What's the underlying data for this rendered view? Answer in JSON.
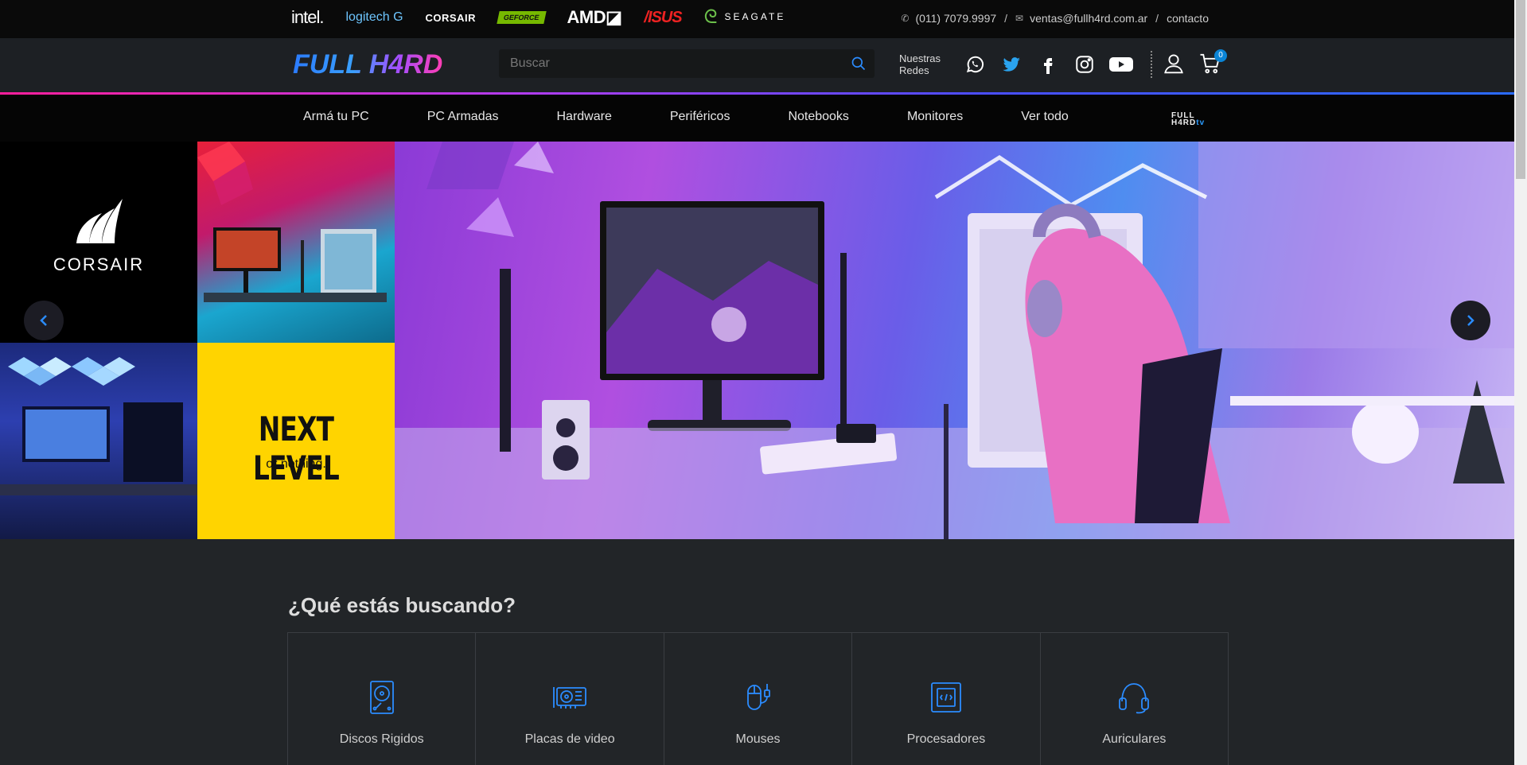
{
  "brands": [
    {
      "name": "intel",
      "label": "intel."
    },
    {
      "name": "logitech",
      "label": "logitech G"
    },
    {
      "name": "corsair",
      "label": "CORSAIR"
    },
    {
      "name": "geforce",
      "label": "GEFORCE"
    },
    {
      "name": "amd",
      "label": "AMD◪"
    },
    {
      "name": "asus",
      "label": "/ISUS"
    },
    {
      "name": "seagate",
      "label": "SEAGATE"
    }
  ],
  "contact": {
    "phone": "(011) 7079.9997",
    "email": "ventas@fullh4rd.com.ar",
    "link": "contacto",
    "separator": "/"
  },
  "header": {
    "logo": "FULL H4RD",
    "search_placeholder": "Buscar",
    "redes_label_1": "Nuestras",
    "redes_label_2": "Redes",
    "cart_count": "0"
  },
  "nav": {
    "items": [
      "Armá tu PC",
      "PC Armadas",
      "Hardware",
      "Periféricos",
      "Notebooks",
      "Monitores",
      "Ver todo"
    ],
    "logo_line1": "FULL",
    "logo_line2": "H4RD",
    "logo_suffix": "tv"
  },
  "hero": {
    "corsair_name": "CORSAIR",
    "slogan_big": "NEXT LEVEL",
    "slogan_small": "or nothing."
  },
  "categories": {
    "title": "¿Qué estás buscando?",
    "items": [
      "Discos Rigidos",
      "Placas de video",
      "Mouses",
      "Procesadores",
      "Auriculares"
    ]
  },
  "colors": {
    "accent": "#2b7bff",
    "pink": "#ff1e9c",
    "yellow": "#ffd400",
    "badge": "#0a84d6"
  }
}
